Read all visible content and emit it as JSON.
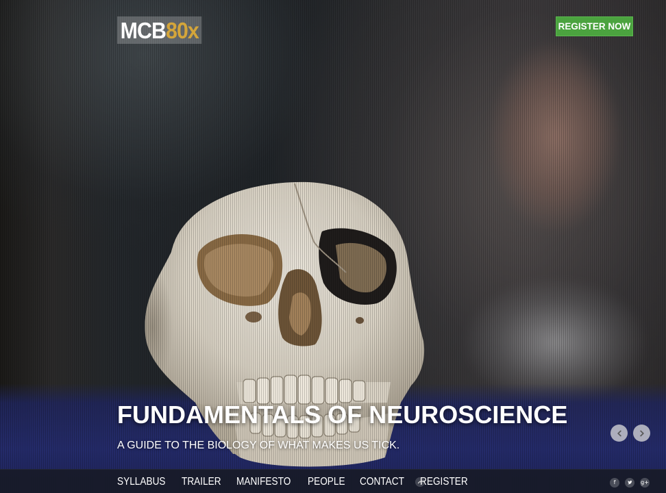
{
  "header": {
    "logo": {
      "part1": "MCB",
      "part2": "80x"
    },
    "register_label": "REGISTER NOW"
  },
  "hero": {
    "title": "FUNDAMENTALS OF NEUROSCIENCE",
    "subtitle": "A GUIDE TO THE BIOLOGY OF WHAT MAKES US TICK.",
    "slider": {
      "prev_icon": "chevron-left-icon",
      "next_icon": "chevron-right-icon"
    }
  },
  "nav": {
    "items": [
      {
        "label": "SYLLABUS"
      },
      {
        "label": "TRAILER"
      },
      {
        "label": "MANIFESTO"
      },
      {
        "label": "PEOPLE"
      },
      {
        "label": "CONTACT"
      },
      {
        "label": "REGISTER"
      }
    ],
    "scroll_top_icon": "chevron-up-icon"
  },
  "social": {
    "facebook": "f",
    "twitter": "twitter-icon",
    "googleplus": "g+"
  },
  "colors": {
    "accent_green": "#4ba33f",
    "logo_gold": "#d4a53a",
    "navbar": "#181b28"
  }
}
